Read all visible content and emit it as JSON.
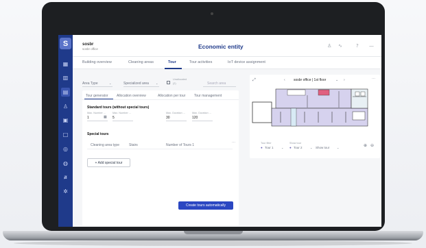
{
  "app": {
    "logo_glyph": "S",
    "site_name": "sosbr",
    "site_subtitle": "sosbr office",
    "page_title": "Economic entity",
    "topbar_icons": [
      "user-icon",
      "activity-icon",
      "help-icon",
      "menu-icon"
    ],
    "topbar_glyphs": [
      "♙",
      "∿",
      "?",
      "—"
    ]
  },
  "sidebar": {
    "items": [
      {
        "name": "building-icon",
        "glyph": "▦"
      },
      {
        "name": "chart-icon",
        "glyph": "▥"
      },
      {
        "name": "tour-icon",
        "glyph": "▤",
        "active": true
      },
      {
        "name": "person-icon",
        "glyph": "♙"
      },
      {
        "name": "calendar-icon",
        "glyph": "▣"
      },
      {
        "name": "device-icon",
        "glyph": "□"
      },
      {
        "name": "settings-icon",
        "glyph": "◎"
      },
      {
        "name": "globe-icon",
        "glyph": "◍"
      },
      {
        "name": "translate-icon",
        "glyph": "ⱥ"
      },
      {
        "name": "gear-icon",
        "glyph": "✲"
      }
    ]
  },
  "tabs": [
    {
      "label": "Building overview"
    },
    {
      "label": "Cleaning areas"
    },
    {
      "label": "Tour",
      "active": true
    },
    {
      "label": "Tour activities"
    },
    {
      "label": "IoT device assignment"
    }
  ],
  "filters": {
    "area_type": "Area Type",
    "specialized_area": "Specialized area",
    "unallocated_label": "Unallocated",
    "unallocated_count": "(2)",
    "search_placeholder": "Search area"
  },
  "subtabs": [
    {
      "label": "Tour generator",
      "active": true
    },
    {
      "label": "Allocation overview"
    },
    {
      "label": "Allocation per tour"
    },
    {
      "label": "Tour management"
    }
  ],
  "standard_tours": {
    "title": "Standard tours (without special tours)",
    "fields": [
      {
        "label": "Max. Number ...",
        "value": "1"
      },
      {
        "label": "Max. Number ...",
        "value": "5"
      },
      {
        "label": "Max. Duration ...",
        "value": "30"
      },
      {
        "label": "Max. Duration ...",
        "value": "120"
      }
    ]
  },
  "special_tours": {
    "title": "Special tours",
    "row": {
      "type_label": "Cleaning area type",
      "type_value": "Stairs",
      "tour_label": "Number of Tours 1"
    },
    "add_button": "+ Add special tour",
    "more_glyph": "⋯"
  },
  "create_button": "Create tours automatically",
  "map": {
    "floor_label": "sosbr office | 1st floor",
    "chevron_down": "⌄",
    "prev_glyph": "‹",
    "next_glyph": "›",
    "expand_glyph": "⤢",
    "more_glyph": "⋯",
    "tour_filter_label": "Tour filter",
    "show_tour_label": "Show tour",
    "tour_1": "Tour 1",
    "tour_2": "Tour 2",
    "show_tour": "Show tour",
    "zoom_in_glyph": "⊕",
    "zoom_out_glyph": "⊖",
    "accent": "#6b63b5"
  }
}
